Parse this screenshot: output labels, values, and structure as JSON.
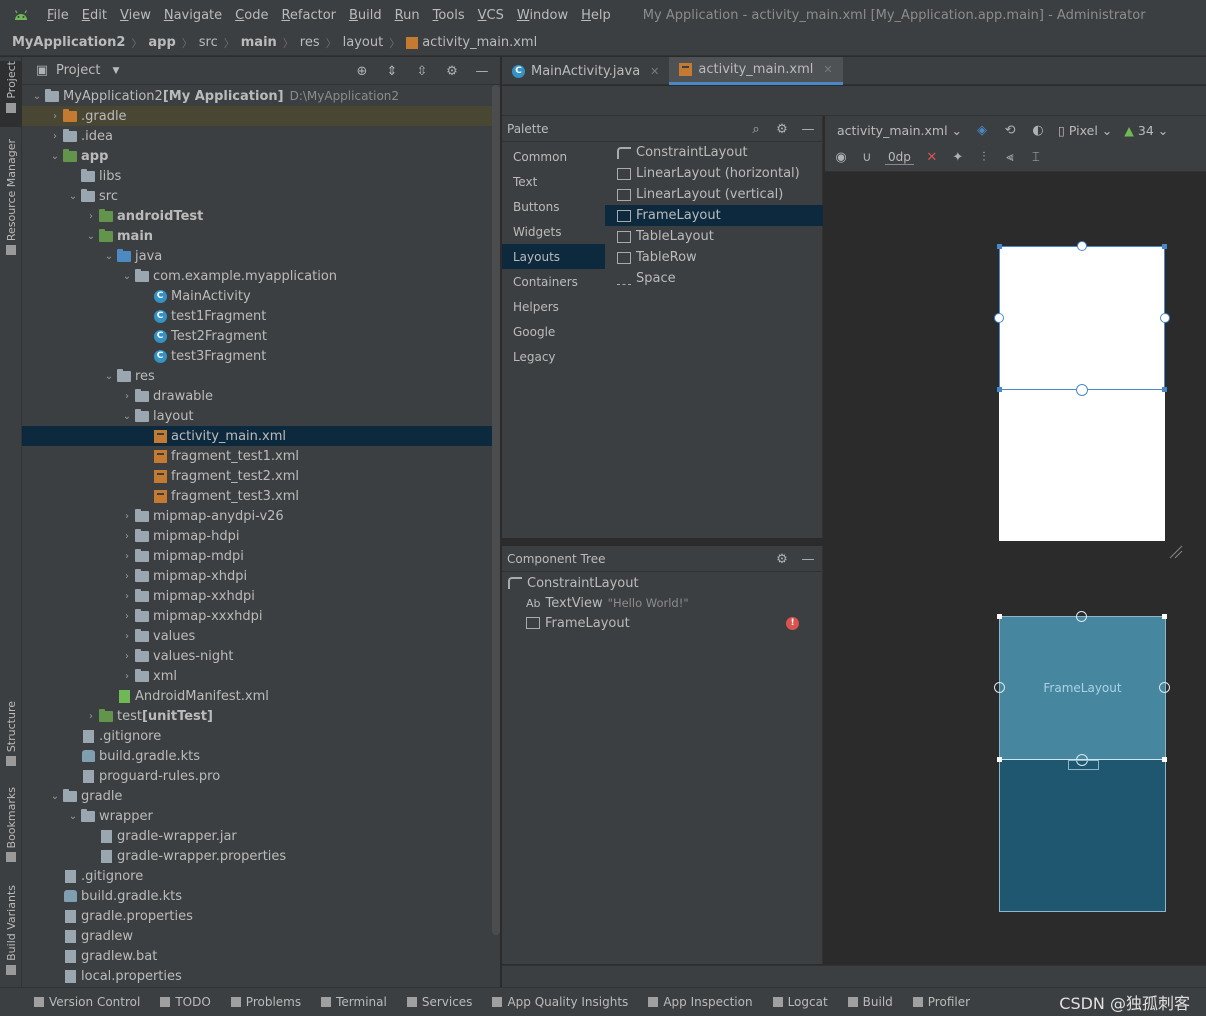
{
  "menu": {
    "items": [
      {
        "u": "F",
        "rest": "ile"
      },
      {
        "u": "E",
        "rest": "dit"
      },
      {
        "u": "V",
        "rest": "iew"
      },
      {
        "u": "N",
        "rest": "avigate"
      },
      {
        "u": "C",
        "rest": "ode"
      },
      {
        "u": "R",
        "rest": "efactor"
      },
      {
        "u": "B",
        "rest": "uild"
      },
      {
        "u": "R",
        "rest": "un"
      },
      {
        "u": "T",
        "rest": "ools"
      },
      {
        "u": "V",
        "rest": "CS"
      },
      {
        "u": "W",
        "rest": "indow"
      },
      {
        "u": "H",
        "rest": "elp"
      }
    ],
    "window_title": "My Application - activity_main.xml [My_Application.app.main] - Administrator"
  },
  "breadcrumb": [
    "MyApplication2",
    "app",
    "src",
    "main",
    "res",
    "layout",
    "activity_main.xml"
  ],
  "left_toolbar": {
    "project": "Project",
    "resource_manager": "Resource Manager",
    "structure": "Structure",
    "bookmarks": "Bookmarks",
    "build_variants": "Build Variants"
  },
  "project_panel": {
    "title": "Project",
    "tree": [
      {
        "depth": 0,
        "arrow": "⌄",
        "icon": "folder",
        "label": "MyApplication2",
        "bold_suffix": " [My Application]",
        "suffix": "D:\\MyApplication2"
      },
      {
        "depth": 1,
        "arrow": "›",
        "icon": "folder-orange",
        "label": ".gradle",
        "highlight": true
      },
      {
        "depth": 1,
        "arrow": "›",
        "icon": "folder",
        "label": ".idea"
      },
      {
        "depth": 1,
        "arrow": "⌄",
        "icon": "folder-green",
        "label": "app",
        "bold": true
      },
      {
        "depth": 2,
        "arrow": "",
        "icon": "folder",
        "label": "libs"
      },
      {
        "depth": 2,
        "arrow": "⌄",
        "icon": "folder",
        "label": "src"
      },
      {
        "depth": 3,
        "arrow": "›",
        "icon": "folder-green",
        "label": "androidTest",
        "bold": true
      },
      {
        "depth": 3,
        "arrow": "⌄",
        "icon": "folder-green",
        "label": "main",
        "bold": true
      },
      {
        "depth": 4,
        "arrow": "⌄",
        "icon": "folder-blue",
        "label": "java"
      },
      {
        "depth": 5,
        "arrow": "⌄",
        "icon": "folder",
        "label": "com.example.myapplication"
      },
      {
        "depth": 6,
        "arrow": "",
        "icon": "class",
        "label": "MainActivity"
      },
      {
        "depth": 6,
        "arrow": "",
        "icon": "class",
        "label": "test1Fragment"
      },
      {
        "depth": 6,
        "arrow": "",
        "icon": "class",
        "label": "Test2Fragment"
      },
      {
        "depth": 6,
        "arrow": "",
        "icon": "class",
        "label": "test3Fragment"
      },
      {
        "depth": 4,
        "arrow": "⌄",
        "icon": "folder",
        "label": "res"
      },
      {
        "depth": 5,
        "arrow": "›",
        "icon": "folder",
        "label": "drawable"
      },
      {
        "depth": 5,
        "arrow": "⌄",
        "icon": "folder",
        "label": "layout"
      },
      {
        "depth": 6,
        "arrow": "",
        "icon": "xml",
        "label": "activity_main.xml",
        "selected": true
      },
      {
        "depth": 6,
        "arrow": "",
        "icon": "xml",
        "label": "fragment_test1.xml"
      },
      {
        "depth": 6,
        "arrow": "",
        "icon": "xml",
        "label": "fragment_test2.xml"
      },
      {
        "depth": 6,
        "arrow": "",
        "icon": "xml",
        "label": "fragment_test3.xml"
      },
      {
        "depth": 5,
        "arrow": "›",
        "icon": "folder",
        "label": "mipmap-anydpi-v26"
      },
      {
        "depth": 5,
        "arrow": "›",
        "icon": "folder",
        "label": "mipmap-hdpi"
      },
      {
        "depth": 5,
        "arrow": "›",
        "icon": "folder",
        "label": "mipmap-mdpi"
      },
      {
        "depth": 5,
        "arrow": "›",
        "icon": "folder",
        "label": "mipmap-xhdpi"
      },
      {
        "depth": 5,
        "arrow": "›",
        "icon": "folder",
        "label": "mipmap-xxhdpi"
      },
      {
        "depth": 5,
        "arrow": "›",
        "icon": "folder",
        "label": "mipmap-xxxhdpi"
      },
      {
        "depth": 5,
        "arrow": "›",
        "icon": "folder",
        "label": "values"
      },
      {
        "depth": 5,
        "arrow": "›",
        "icon": "folder",
        "label": "values-night"
      },
      {
        "depth": 5,
        "arrow": "›",
        "icon": "folder",
        "label": "xml"
      },
      {
        "depth": 4,
        "arrow": "",
        "icon": "manifest",
        "label": "AndroidManifest.xml"
      },
      {
        "depth": 3,
        "arrow": "›",
        "icon": "folder-green",
        "label": "test",
        "bold_suffix": " [unitTest]"
      },
      {
        "depth": 2,
        "arrow": "",
        "icon": "file",
        "label": ".gitignore"
      },
      {
        "depth": 2,
        "arrow": "",
        "icon": "gradle",
        "label": "build.gradle.kts"
      },
      {
        "depth": 2,
        "arrow": "",
        "icon": "file",
        "label": "proguard-rules.pro"
      },
      {
        "depth": 1,
        "arrow": "⌄",
        "icon": "folder",
        "label": "gradle"
      },
      {
        "depth": 2,
        "arrow": "⌄",
        "icon": "folder",
        "label": "wrapper"
      },
      {
        "depth": 3,
        "arrow": "",
        "icon": "file",
        "label": "gradle-wrapper.jar"
      },
      {
        "depth": 3,
        "arrow": "",
        "icon": "file",
        "label": "gradle-wrapper.properties"
      },
      {
        "depth": 1,
        "arrow": "",
        "icon": "file",
        "label": ".gitignore"
      },
      {
        "depth": 1,
        "arrow": "",
        "icon": "gradle",
        "label": "build.gradle.kts"
      },
      {
        "depth": 1,
        "arrow": "",
        "icon": "file",
        "label": "gradle.properties"
      },
      {
        "depth": 1,
        "arrow": "",
        "icon": "file",
        "label": "gradlew"
      },
      {
        "depth": 1,
        "arrow": "",
        "icon": "file",
        "label": "gradlew.bat"
      },
      {
        "depth": 1,
        "arrow": "",
        "icon": "file",
        "label": "local.properties"
      }
    ]
  },
  "editor_tabs": [
    {
      "label": "MainActivity.java",
      "icon": "class",
      "active": false
    },
    {
      "label": "activity_main.xml",
      "icon": "xml",
      "active": true
    }
  ],
  "palette": {
    "title": "Palette",
    "categories": [
      "Common",
      "Text",
      "Buttons",
      "Widgets",
      "Layouts",
      "Containers",
      "Helpers",
      "Google",
      "Legacy"
    ],
    "selected_category": "Layouts",
    "widgets": [
      "ConstraintLayout",
      "LinearLayout (horizontal)",
      "LinearLayout (vertical)",
      "FrameLayout",
      "TableLayout",
      "TableRow",
      "Space"
    ],
    "selected_widget": "FrameLayout"
  },
  "component_tree": {
    "title": "Component Tree",
    "items": [
      {
        "depth": 0,
        "icon": "constraint-icon",
        "label": "ConstraintLayout",
        "hint": ""
      },
      {
        "depth": 1,
        "icon": "textview-icon",
        "prefix": "Ab",
        "label": "TextView",
        "hint": "\"Hello World!\""
      },
      {
        "depth": 1,
        "icon": "framelayout-icon",
        "label": "FrameLayout",
        "hint": "",
        "error": true
      }
    ]
  },
  "design_toolbar": {
    "file": "activity_main.xml",
    "device": "Pixel",
    "api": "34",
    "margin": "0dp"
  },
  "design": {
    "blueprint_label": "FrameLayout"
  },
  "statusbar": [
    "Version Control",
    "TODO",
    "Problems",
    "Terminal",
    "Services",
    "App Quality Insights",
    "App Inspection",
    "Logcat",
    "Build",
    "Profiler"
  ],
  "watermark": "CSDN @独孤刺客",
  "colors": {
    "selection": "#0d293e",
    "accent": "#4a88c7",
    "blueprint": "#1f5670"
  }
}
